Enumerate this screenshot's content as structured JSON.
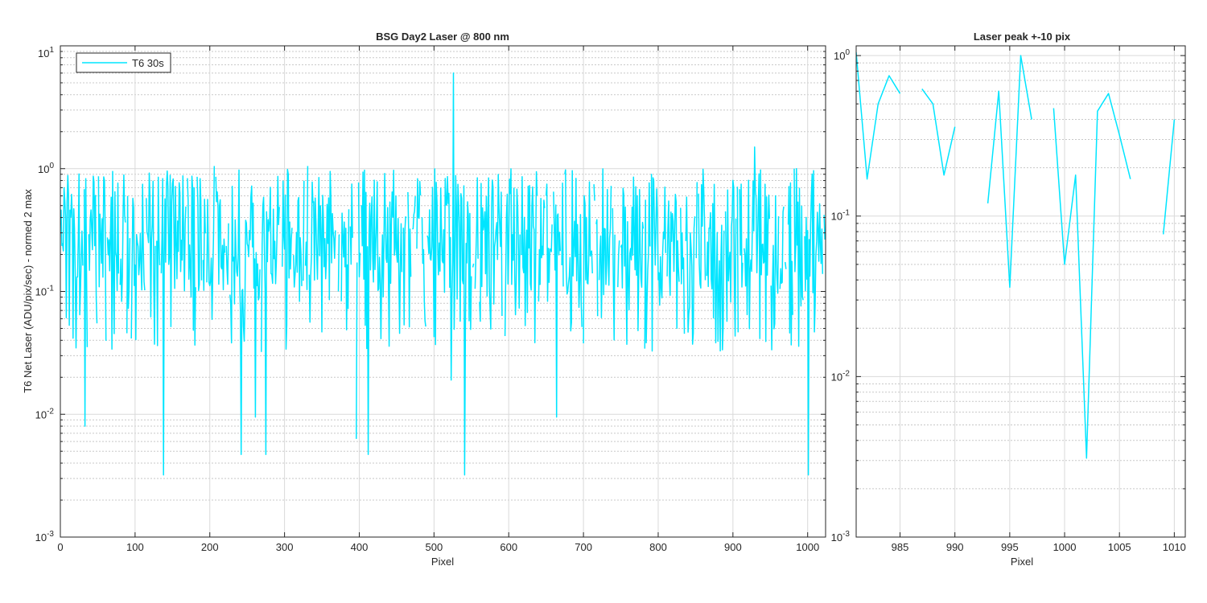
{
  "chart_data": [
    {
      "type": "line",
      "title": "BSG  Day2 Laser @ 800 nm",
      "xlabel": "Pixel",
      "ylabel": "T6 Net Laser (ADU/pix/sec) - normed 2 max",
      "xlim": [
        0,
        1024
      ],
      "ylim": [
        0.001,
        10
      ],
      "yscale": "log",
      "grid": true,
      "legend": {
        "location": "top-left",
        "entries": [
          "T6 30s"
        ]
      },
      "xticks": [
        "0",
        "100",
        "200",
        "300",
        "400",
        "500",
        "600",
        "700",
        "800",
        "900",
        "1000"
      ],
      "yticks": [
        {
          "base": "10",
          "exp": "-3"
        },
        {
          "base": "10",
          "exp": "-2"
        },
        {
          "base": "10",
          "exp": "-1"
        },
        {
          "base": "10",
          "exp": "0"
        },
        {
          "base": "10",
          "exp": "1"
        }
      ],
      "series": [
        {
          "name": "T6 30s",
          "color": "#00E5FF",
          "notable_points": [
            {
              "x": 0,
              "y": 0.35
            },
            {
              "x": 7,
              "y": 0.4
            },
            {
              "x": 12,
              "y": 0.053
            },
            {
              "x": 33,
              "y": 0.008
            },
            {
              "x": 70,
              "y": 0.95
            },
            {
              "x": 138,
              "y": 0.0032
            },
            {
              "x": 206,
              "y": 1.05
            },
            {
              "x": 242,
              "y": 0.0047
            },
            {
              "x": 261,
              "y": 0.0095
            },
            {
              "x": 275,
              "y": 0.0047
            },
            {
              "x": 331,
              "y": 1.05
            },
            {
              "x": 396,
              "y": 0.0063
            },
            {
              "x": 412,
              "y": 0.0047
            },
            {
              "x": 523,
              "y": 0.019
            },
            {
              "x": 526,
              "y": 6.0
            },
            {
              "x": 541,
              "y": 0.0032
            },
            {
              "x": 664,
              "y": 0.0095
            },
            {
              "x": 929,
              "y": 1.5
            },
            {
              "x": 1001,
              "y": 0.0032
            },
            {
              "x": 1022,
              "y": 0.42
            }
          ]
        }
      ]
    },
    {
      "type": "line",
      "title": "Laser peak +-10 pix",
      "xlabel": "Pixel",
      "ylabel": "",
      "xlim": [
        981,
        1011
      ],
      "ylim": [
        0.001,
        1.15
      ],
      "yscale": "log",
      "grid": true,
      "xticks": [
        "985",
        "990",
        "995",
        "1000",
        "1005",
        "1010"
      ],
      "yticks": [
        {
          "base": "10",
          "exp": "-3"
        },
        {
          "base": "10",
          "exp": "-2"
        },
        {
          "base": "10",
          "exp": "-1"
        },
        {
          "base": "10",
          "exp": "0"
        }
      ],
      "series": [
        {
          "name": "T6 30s",
          "color": "#00E5FF",
          "x": [
            981,
            982,
            983,
            984,
            985,
            986,
            987,
            988,
            989,
            990,
            991,
            992,
            993,
            994,
            995,
            996,
            997,
            998,
            999,
            1000,
            1001,
            1002,
            1003,
            1004,
            1005,
            1006,
            1007,
            1008,
            1009,
            1010
          ],
          "y": [
            1.05,
            0.17,
            0.5,
            0.75,
            0.58,
            null,
            0.62,
            0.5,
            0.18,
            0.36,
            null,
            null,
            0.12,
            0.6,
            0.036,
            1.0,
            0.4,
            null,
            0.47,
            0.05,
            0.18,
            0.0031,
            0.45,
            0.58,
            0.32,
            0.17,
            null,
            null,
            0.077,
            0.4
          ]
        }
      ]
    }
  ]
}
